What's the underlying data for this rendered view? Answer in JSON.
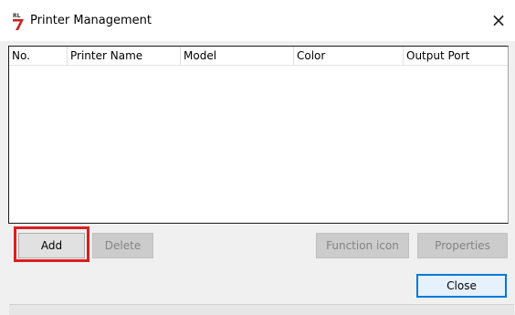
{
  "window": {
    "title": "Printer Management",
    "close_glyph": "×",
    "icon": "app-logo-icon"
  },
  "table": {
    "columns": [
      "No.",
      "Printer Name",
      "Model",
      "Color",
      "Output Port"
    ],
    "rows": []
  },
  "buttons": {
    "add": "Add",
    "delete": "Delete",
    "function_icon": "Function icon",
    "properties": "Properties",
    "close": "Close"
  },
  "colors": {
    "highlight": "#d9201f",
    "focus_border": "#0078d7",
    "logo_red": "#c8201e"
  }
}
